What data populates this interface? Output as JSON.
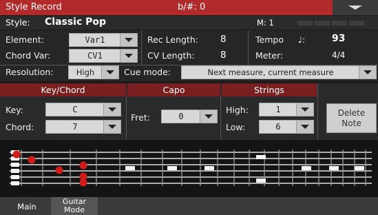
{
  "titlebar": {
    "title": "Style Record",
    "transpose": "b/#: 0"
  },
  "style": {
    "label": "Style:",
    "name": "Classic Pop",
    "measure": "M: 1"
  },
  "element": {
    "label": "Element:",
    "value": "Var1"
  },
  "chord_var": {
    "label": "Chord Var:",
    "value": "CV1"
  },
  "rec_length": {
    "label": "Rec Length:",
    "value": "8"
  },
  "cv_length": {
    "label": "CV Length:",
    "value": "8"
  },
  "tempo": {
    "label": "Tempo",
    "symbol": "♩:",
    "value": "93"
  },
  "meter": {
    "label": "Meter:",
    "value": "4/4"
  },
  "resolution": {
    "label": "Resolution:",
    "value": "High"
  },
  "cue_mode": {
    "label": "Cue mode:",
    "value": "Next measure, current measure"
  },
  "key_chord": {
    "header": "Key/Chord",
    "key_label": "Key:",
    "key_value": "C",
    "chord_label": "Chord:",
    "chord_value": "7"
  },
  "capo": {
    "header": "Capo",
    "fret_label": "Fret:",
    "fret_value": "0"
  },
  "strings": {
    "header": "Strings",
    "high_label": "High:",
    "high_value": "1",
    "low_label": "Low:",
    "low_value": "6"
  },
  "delete_note": {
    "line1": "Delete",
    "line2": "Note"
  },
  "tabs": {
    "main": "Main",
    "guitar_line1": "Guitar",
    "guitar_line2": "Mode"
  },
  "colors": {
    "accent": "#b32a2a",
    "section_header": "#7a1f1f",
    "note": "#d11c1c"
  }
}
